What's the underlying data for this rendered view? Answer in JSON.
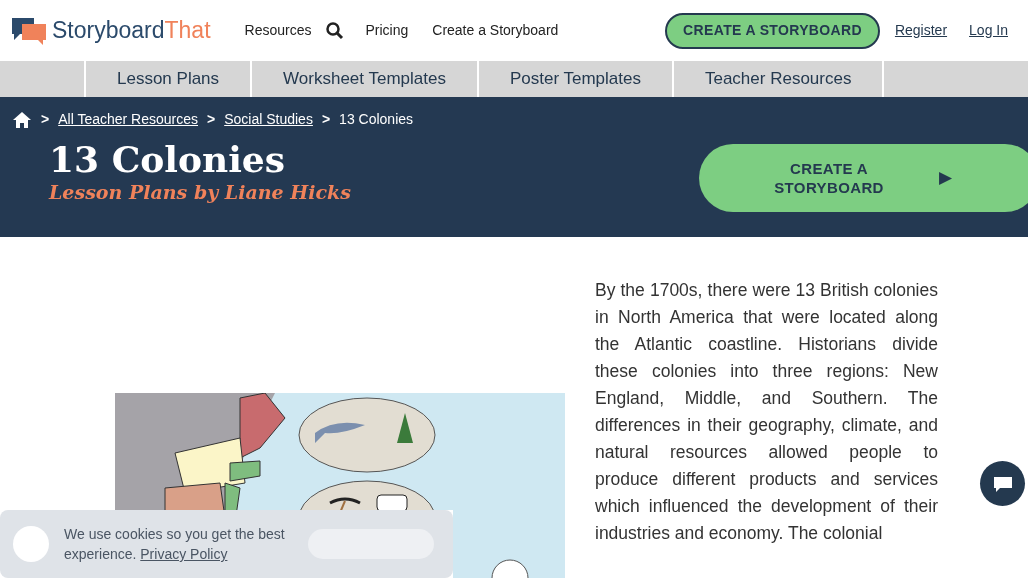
{
  "header": {
    "logo": {
      "part_1": "Storyboard",
      "part_2": "That"
    },
    "nav": [
      "Resources",
      "Pricing",
      "Create a Storyboard"
    ],
    "cta": "CREATE A STORYBOARD",
    "links": [
      "Register",
      "Log In"
    ]
  },
  "subnav": [
    {
      "label": "Lesson Plans"
    },
    {
      "label": "Worksheet Templates"
    },
    {
      "label": "Poster Templates"
    },
    {
      "label": "Teacher Resources"
    }
  ],
  "breadcrumb_separator": ">",
  "breadcrumb": [
    {
      "label": "All Teacher Resources",
      "link": true
    },
    {
      "label": "Social Studies",
      "link": true
    },
    {
      "label": "13 Colonies",
      "link": false
    }
  ],
  "hero": {
    "title": "13 Colonies",
    "subtitle": "Lesson Plans by Liane Hicks",
    "button": "CREATE A STORYBOARD",
    "button_icon": "▶"
  },
  "body": "By the 1700s, there were 13 British colonies in North America that were located along the Atlantic coastline. Historians divide these colonies into three regions: New England, Middle, and Southern. The differences in their geography, climate, and natural resources allowed people to produce different products and services which influenced the development of their industries and economy. The colonial",
  "cookie_banner": {
    "text": "We use cookies so you get the best experience.",
    "link": "Privacy Policy"
  }
}
